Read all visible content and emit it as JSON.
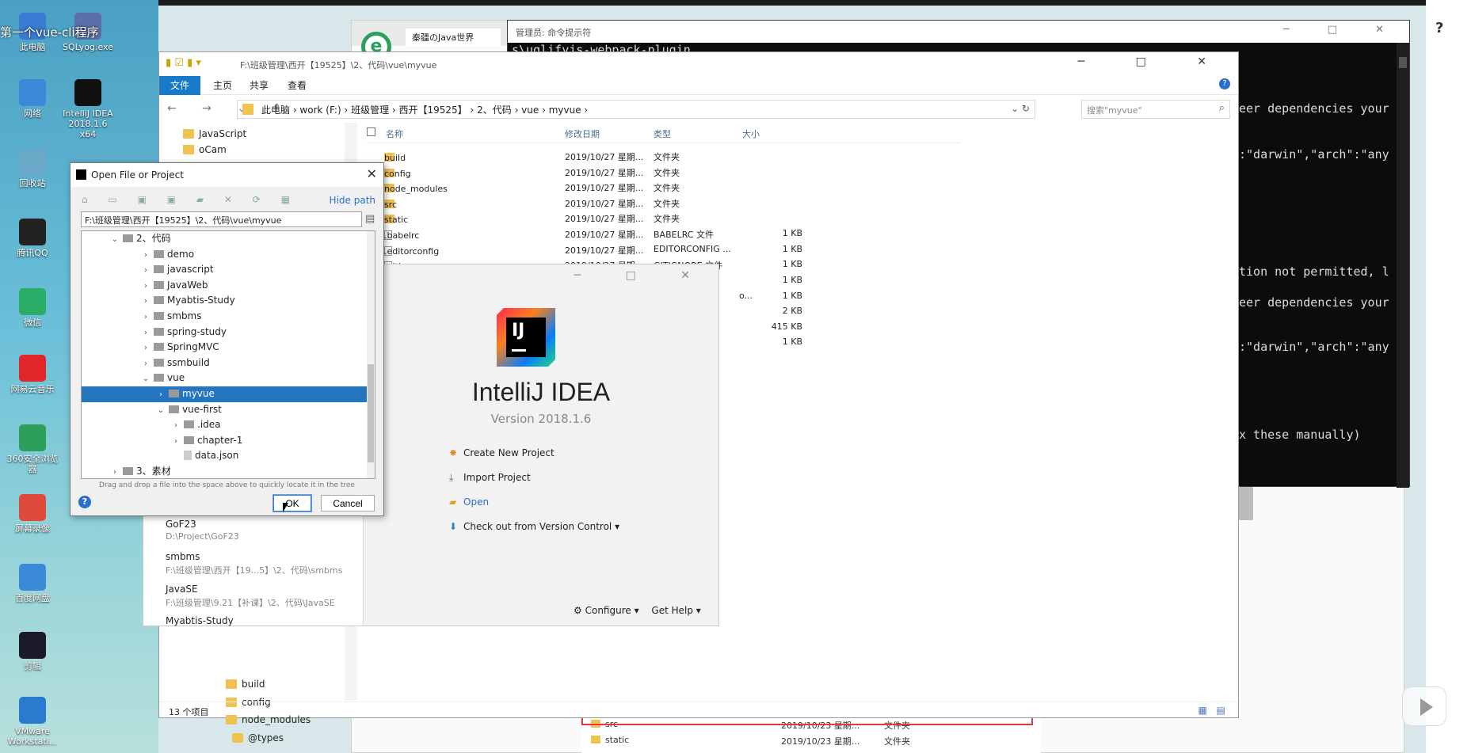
{
  "video": {
    "title": "第一个vue-cli程序"
  },
  "desktop_icons": [
    {
      "label": "此电脑",
      "color": "#3a7ad0"
    },
    {
      "label": "SQLyog.exe",
      "color": "#5a6fa8"
    },
    {
      "label": "网络",
      "color": "#3a8ad8"
    },
    {
      "label": "IntelliJ IDEA 2018.1.6 x64",
      "color": "#111111"
    },
    {
      "label": "回收站",
      "color": "#6aa8c8"
    },
    {
      "label": "腾讯QQ",
      "color": "#222222"
    },
    {
      "label": "微信",
      "color": "#2aae67"
    },
    {
      "label": "网易云音乐",
      "color": "#e0262b"
    },
    {
      "label": "360安全浏览器",
      "color": "#2c9f5c"
    },
    {
      "label": "屏幕录像",
      "color": "#e04a3a"
    },
    {
      "label": "百度网盘",
      "color": "#3a8ad8"
    },
    {
      "label": "剪辑",
      "color": "#1a1a2a"
    },
    {
      "label": "VMware Workstati...",
      "color": "#2a7ad0"
    }
  ],
  "browser": {
    "tab": "秦疆のJava世界"
  },
  "cmd": {
    "title": "管理员: 命令提示符",
    "controls": "─ □ ✕",
    "pkg": "s\\uglifyjs-webpack-plugin",
    "lines": [
      "eer dependencies your",
      ":\"darwin\",\"arch\":\"any",
      "tion not permitted, l",
      "eer dependencies your",
      ":\"darwin\",\"arch\":\"any",
      "x these manually)"
    ]
  },
  "explorer": {
    "title_path": "F:\\班级管理\\西开【19525】\\2、代码\\vue\\myvue",
    "window_controls": "─ □ ✕",
    "ribbon_tabs": [
      "文件",
      "主页",
      "共享",
      "查看"
    ],
    "address_parts": "此电脑 › work (F:) › 班级管理 › 西开【19525】 › 2、代码 › vue › myvue ›",
    "search_placeholder": "搜索\"myvue\"",
    "nav_items_top": [
      "JavaScript",
      "oCam"
    ],
    "nav_items_bottom": [
      "build",
      "config",
      "node_modules",
      "@types"
    ],
    "columns": {
      "name": "名称",
      "date": "修改日期",
      "type": "类型",
      "size": "大小"
    },
    "files": [
      {
        "name": "build",
        "date": "2019/10/27 星期...",
        "type": "文件夹",
        "size": "",
        "kind": "folder"
      },
      {
        "name": "config",
        "date": "2019/10/27 星期...",
        "type": "文件夹",
        "size": "",
        "kind": "folder"
      },
      {
        "name": "node_modules",
        "date": "2019/10/27 星期...",
        "type": "文件夹",
        "size": "",
        "kind": "folder"
      },
      {
        "name": "src",
        "date": "2019/10/27 星期...",
        "type": "文件夹",
        "size": "",
        "kind": "folder"
      },
      {
        "name": "static",
        "date": "2019/10/27 星期...",
        "type": "文件夹",
        "size": "",
        "kind": "folder"
      },
      {
        "name": ".babelrc",
        "date": "2019/10/27 星期...",
        "type": "BABELRC 文件",
        "size": "1 KB",
        "kind": "file"
      },
      {
        "name": ".editorconfig",
        "date": "2019/10/27 星期...",
        "type": "EDITORCONFIG ...",
        "size": "1 KB",
        "kind": "file"
      },
      {
        "name": ".gitignore",
        "date": "2019/10/27 星期...",
        "type": "GITIGNORE 文件",
        "size": "1 KB",
        "kind": "file"
      }
    ],
    "hidden_rows": [
      {
        "type": "",
        "size": "1 KB"
      },
      {
        "type": "o...",
        "size": "1 KB"
      },
      {
        "type": "",
        "size": "2 KB"
      },
      {
        "type": "",
        "size": "415 KB"
      },
      {
        "type": "",
        "size": "1 KB"
      }
    ],
    "status": "13 个项目"
  },
  "bg_list": [
    {
      "name": "src",
      "date": "2019/10/23 星期...",
      "type": "文件夹"
    },
    {
      "name": "static",
      "date": "2019/10/23 星期...",
      "type": "文件夹"
    }
  ],
  "idea": {
    "logo_text": "IJ",
    "name": "IntelliJ IDEA",
    "version": "Version 2018.1.6",
    "window_controls": "─ □ ✕",
    "actions": [
      "Create New Project",
      "Import Project",
      "Open",
      "Check out from Version Control ▾"
    ],
    "configure": "Configure ▾",
    "get_help": "Get Help ▾",
    "recent": [
      {
        "name": "GoF23",
        "path": "D:\\Project\\GoF23"
      },
      {
        "name": "smbms",
        "path": "F:\\班级管理\\西开【19...5】\\2、代码\\smbms"
      },
      {
        "name": "JavaSE",
        "path": "F:\\班级管理\\9.21【补课】\\2、代码\\JavaSE"
      },
      {
        "name": "Myabtis-Study",
        "path": ""
      }
    ]
  },
  "dialog": {
    "title": "Open File or Project",
    "hide_path": "Hide path",
    "path_value": "F:\\班级管理\\西开【19525】\\2、代码\\vue\\myvue",
    "tree": [
      {
        "label": "2、代码",
        "depth": 0,
        "chev": "⌄",
        "kind": "dir"
      },
      {
        "label": "demo",
        "depth": 1,
        "chev": "›",
        "kind": "dir"
      },
      {
        "label": "javascript",
        "depth": 1,
        "chev": "›",
        "kind": "dir"
      },
      {
        "label": "JavaWeb",
        "depth": 1,
        "chev": "›",
        "kind": "dir"
      },
      {
        "label": "Myabtis-Study",
        "depth": 1,
        "chev": "›",
        "kind": "dir"
      },
      {
        "label": "smbms",
        "depth": 1,
        "chev": "›",
        "kind": "dir"
      },
      {
        "label": "spring-study",
        "depth": 1,
        "chev": "›",
        "kind": "dir"
      },
      {
        "label": "SpringMVC",
        "depth": 1,
        "chev": "›",
        "kind": "dir"
      },
      {
        "label": "ssmbuild",
        "depth": 1,
        "chev": "›",
        "kind": "dir"
      },
      {
        "label": "vue",
        "depth": 1,
        "chev": "⌄",
        "kind": "dir"
      },
      {
        "label": "myvue",
        "depth": 2,
        "chev": "›",
        "kind": "dir",
        "selected": true
      },
      {
        "label": "vue-first",
        "depth": 2,
        "chev": "⌄",
        "kind": "dir"
      },
      {
        "label": ".idea",
        "depth": 3,
        "chev": "›",
        "kind": "dir"
      },
      {
        "label": "chapter-1",
        "depth": 3,
        "chev": "›",
        "kind": "dir"
      },
      {
        "label": "data.json",
        "depth": 3,
        "chev": "",
        "kind": "file"
      },
      {
        "label": "3、素材",
        "depth": 0,
        "chev": "›",
        "kind": "dir"
      }
    ],
    "hint": "Drag and drop a file into the space above to quickly locate it in the tree",
    "ok": "OK",
    "cancel": "Cancel"
  },
  "help_symbol": "?"
}
